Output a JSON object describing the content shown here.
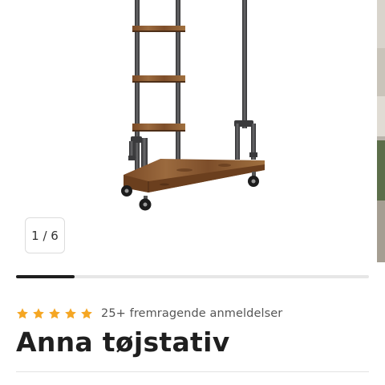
{
  "gallery": {
    "current_slide": 1,
    "total_slides": 6,
    "counter_label": "1 / 6",
    "progress_fraction": 0.1667,
    "image_description": "Industrial pipe clothing rack with wooden shelves on wheels"
  },
  "product": {
    "rating_stars": 5,
    "star_color": "#f5a623",
    "review_summary": "25+ fremragende anmeldelser",
    "title": "Anna tøjstativ"
  },
  "colors": {
    "pipe": "#4a4a4c",
    "wood": "#8a5a32",
    "progress_fill": "#1e1e1e",
    "progress_track": "#e6e6e6"
  }
}
